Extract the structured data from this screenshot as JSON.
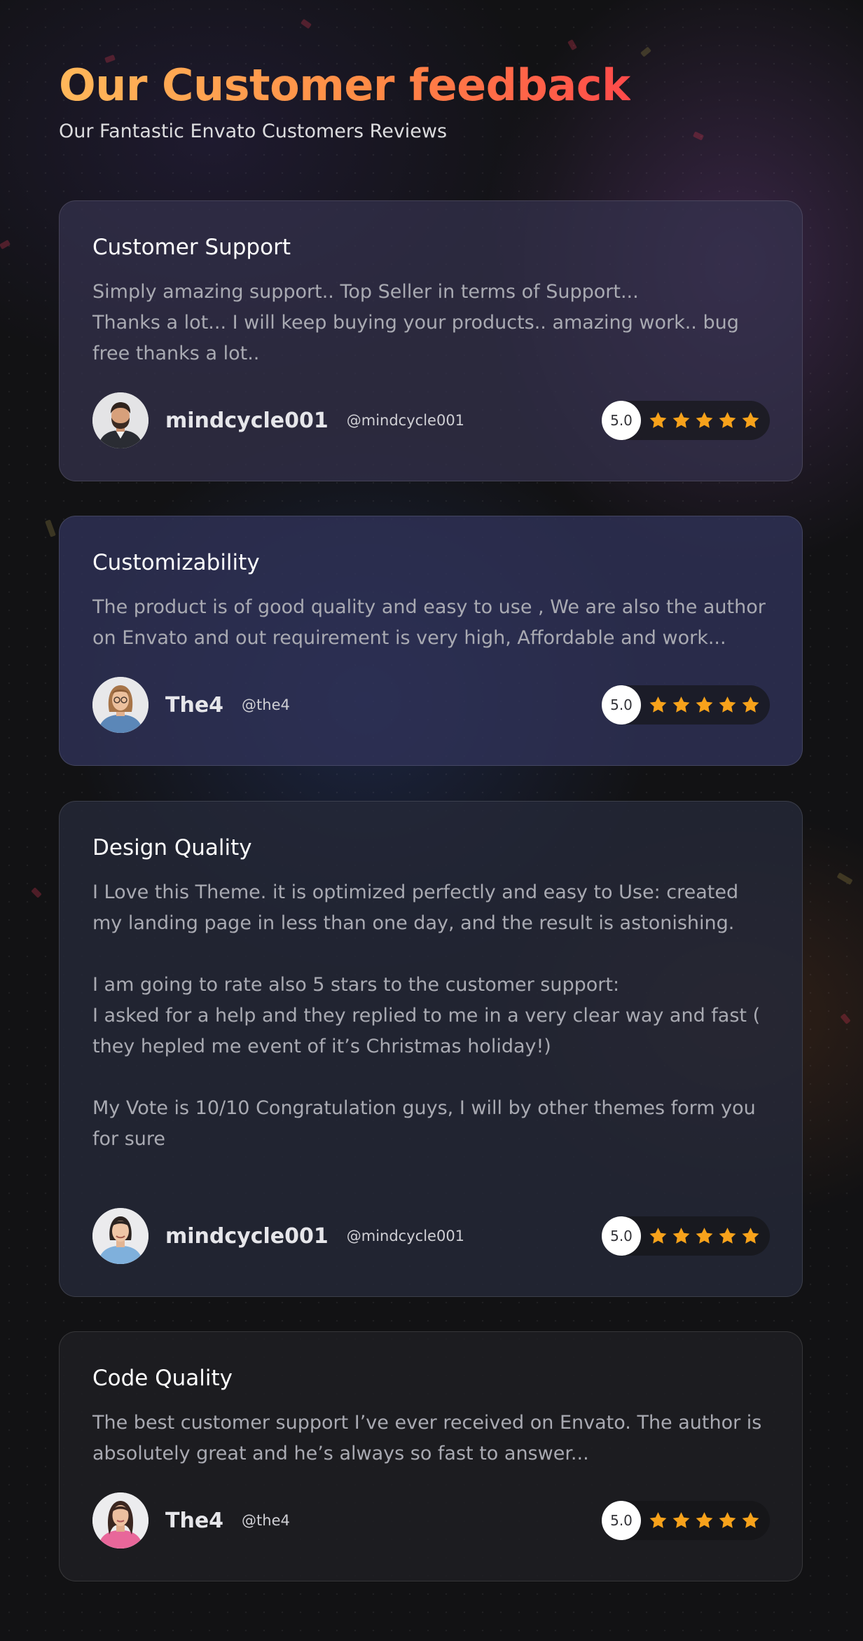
{
  "header": {
    "title": "Our Customer feedback",
    "subtitle": "Our Fantastic Envato Customers Reviews"
  },
  "colors": {
    "title_gradient_start": "#ffb85a",
    "title_gradient_end": "#ff4a4a",
    "star": "#f7a21b",
    "score_badge": "#ffffff"
  },
  "reviews": [
    {
      "title": "Customer Support",
      "text": "Simply amazing support.. Top Seller in terms of Support...\nThanks a lot... I will keep buying your products.. amazing work.. bug free thanks a lot..",
      "user": {
        "name": "mindcycle001",
        "handle": "@mindcycle001",
        "avatar": "man-with-beard-avatar"
      },
      "rating": {
        "score": "5.0",
        "stars": 5
      }
    },
    {
      "title": "Customizability",
      "text": "The product is of good quality and easy to use , We are also the author on Envato and out requirement is very high, Affordable and work...",
      "user": {
        "name": "The4",
        "handle": "@the4",
        "avatar": "woman-with-glasses-avatar"
      },
      "rating": {
        "score": "5.0",
        "stars": 5
      }
    },
    {
      "title": "Design Quality",
      "text": "I Love this Theme. it is optimized perfectly and easy to Use: created my landing page in less than one day, and the result is astonishing.\n\nI am going to rate also 5 stars to the customer support:\nI asked for a help and they replied to me in a very clear way and fast ( they hepled me event of it’s Christmas holiday!)\n\nMy Vote is 10/10 Congratulation guys, I will by other themes form you for sure",
      "user": {
        "name": "mindcycle001",
        "handle": "@mindcycle001",
        "avatar": "smiling-woman-avatar"
      },
      "rating": {
        "score": "5.0",
        "stars": 5
      }
    },
    {
      "title": "Code Quality",
      "text": "The best customer support I’ve ever received on Envato. The author is absolutely great and he’s always so fast to answer...",
      "user": {
        "name": "The4",
        "handle": "@the4",
        "avatar": "woman-pink-top-avatar"
      },
      "rating": {
        "score": "5.0",
        "stars": 5
      }
    }
  ]
}
